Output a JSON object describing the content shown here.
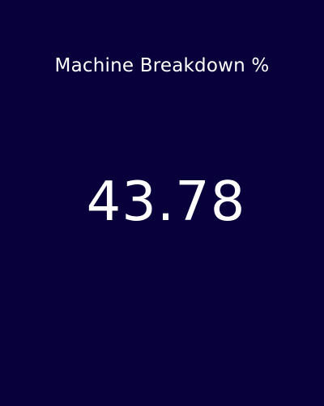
{
  "kpi_card": {
    "title": "Machine Breakdown %",
    "value": "43.78"
  },
  "colors": {
    "background": "#07003a",
    "text": "#ffffff"
  }
}
